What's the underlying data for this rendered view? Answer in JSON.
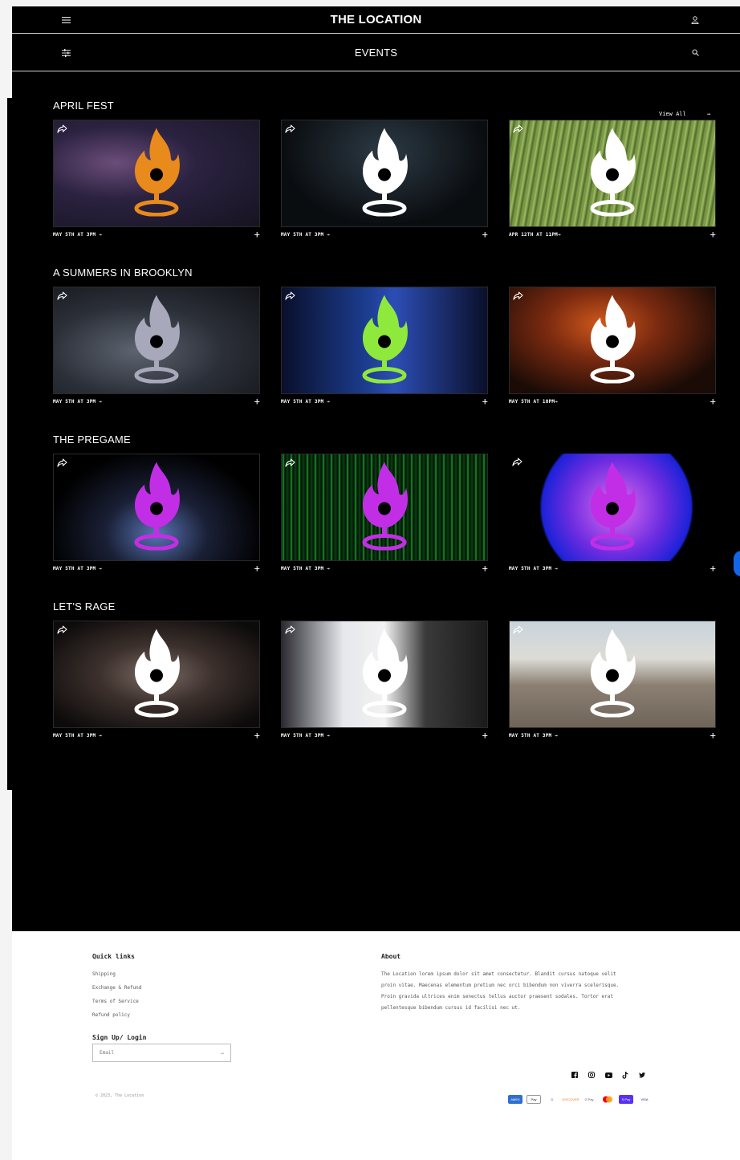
{
  "header": {
    "title": "THE LOCATION",
    "menu_icon": "hamburger-menu-icon",
    "account_icon": "user-icon"
  },
  "subheader": {
    "title": "EVENTS",
    "filter_icon": "filter-sliders-icon",
    "search_icon": "search-icon"
  },
  "view_all": {
    "label": "View All",
    "arrow": "→"
  },
  "sections": [
    {
      "title": "APRIL FEST",
      "events": [
        {
          "date": "MAY 5TH AT 3PM →",
          "logo_color": "#e98a1c"
        },
        {
          "date": "MAY 5TH AT 3PM →",
          "logo_color": "#ffffff"
        },
        {
          "date": "APR 12TH AT 11PM→",
          "logo_color": "#ffffff"
        }
      ]
    },
    {
      "title": "A SUMMERS IN BROOKLYN",
      "events": [
        {
          "date": "MAY 5TH AT 3PM →",
          "logo_color": "#a7a9bb"
        },
        {
          "date": "MAY 5TH AT 3PM →",
          "logo_color": "#8fe83c"
        },
        {
          "date": "MAY 5TH AT 10PM→",
          "logo_color": "#ffffff"
        }
      ]
    },
    {
      "title": "THE PREGAME",
      "events": [
        {
          "date": "MAY 5TH AT 3PM →",
          "logo_color": "#c22ee6"
        },
        {
          "date": "MAY 5TH AT 3PM →",
          "logo_color": "#c22ee6"
        },
        {
          "date": "MAY 5TH AT 3PM →",
          "logo_color": "#c22ee6"
        }
      ]
    },
    {
      "title": "LET'S RAGE",
      "events": [
        {
          "date": "MAY 5TH AT 3PM →",
          "logo_color": "#ffffff"
        },
        {
          "date": "MAY 5TH AT 3PM →",
          "logo_color": "#ffffff"
        },
        {
          "date": "MAY 5TH AT 3PM →",
          "logo_color": "#ffffff"
        }
      ]
    }
  ],
  "plus_label": "+",
  "footer": {
    "quick_links_title": "Quick links",
    "quick_links": [
      "Shipping",
      "Exchange & Refund",
      "Terms of Service",
      "Refund policy"
    ],
    "signup_title": "Sign Up/ Login",
    "email_placeholder": "Email",
    "email_arrow": "→",
    "about_title": "About",
    "about_lines": [
      "The Location lorem ipsum dolor sit amet consectetur. Blandit cursus natoque velit",
      "proin vitae. Maecenas elementum pretium nec orci bibendum non viverra scelerisque.",
      "Proin gravida ultrices enim senectus tellus auctor praesent sodales. Tortor erat",
      "pellentesque bibendum cursus id facilisi nec ut."
    ],
    "copyright": "© 2023, The Location",
    "social_icons": [
      "facebook-icon",
      "instagram-icon",
      "youtube-icon",
      "tiktok-icon",
      "twitter-icon"
    ],
    "payment_methods": [
      "AMEX",
      "Pay",
      "D",
      "DISCOVER",
      "G Pay",
      "MC",
      "S Pay",
      "VISA"
    ]
  }
}
